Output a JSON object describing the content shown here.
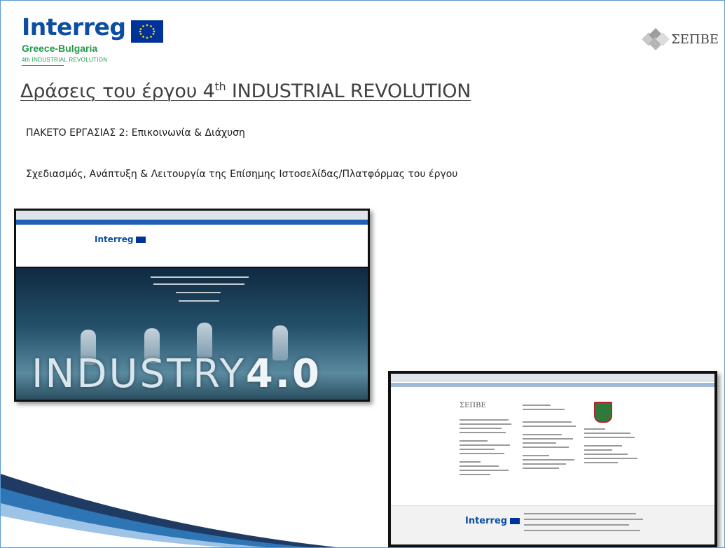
{
  "logos": {
    "interreg_word": "Interreg",
    "interreg_region": "Greece-Bulgaria",
    "interreg_project": "4th INDUSTRIAL REVOLUTION",
    "sepve_text": "ΣΕΠΒΕ"
  },
  "title_main": "Δράσεις του έργου 4",
  "title_sup": "th",
  "title_rest": " INDUSTRIAL REVOLUTION",
  "work_package": "ΠΑΚΕΤΟ ΕΡΓΑΣΙΑΣ 2: Επικοινωνία & Διάχυση",
  "description": "Σχεδιασμός, Ανάπτυξη & Λειτουργία της Επίσημης Ιστοσελίδας/Πλατφόρμας του έργου",
  "screenshot1": {
    "logo": "Interreg",
    "hero_word": "INDUSTRY",
    "hero_number": "4.0"
  },
  "screenshot2": {
    "partner_logo": "ΣΕΠΒΕ",
    "footer_logo": "Interreg"
  },
  "colors": {
    "interreg_blue": "#0b4ea2",
    "interreg_green": "#1f9b4a",
    "eu_blue": "#003399",
    "swoosh_dark": "#1f3b63",
    "swoosh_light": "#2e75b6"
  }
}
